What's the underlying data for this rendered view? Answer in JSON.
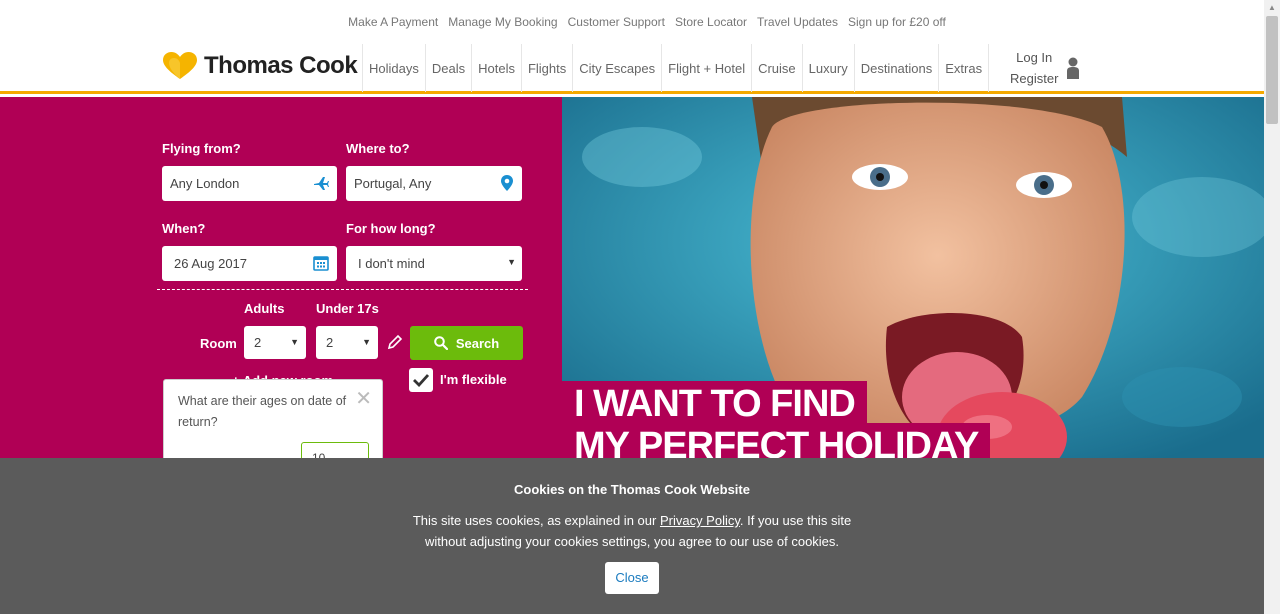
{
  "util_links": [
    "Make A Payment",
    "Manage My Booking",
    "Customer Support",
    "Store Locator",
    "Travel Updates",
    "Sign up for £20 off"
  ],
  "brand": {
    "name": "Thomas Cook",
    "accent": "#f5a900",
    "primary": "#b00055",
    "green": "#6cbb0c"
  },
  "nav": [
    "Holidays",
    "Deals",
    "Hotels",
    "Flights",
    "City Escapes",
    "Flight + Hotel",
    "Cruise",
    "Luxury",
    "Destinations",
    "Extras"
  ],
  "account": {
    "login": "Log In",
    "register": "Register",
    "icon": "user-icon"
  },
  "search": {
    "from_label": "Flying from?",
    "from_value": "Any London",
    "to_label": "Where to?",
    "to_value": "Portugal, Any",
    "when_label": "When?",
    "when_value": "26 Aug 2017",
    "duration_label": "For how long?",
    "duration_value": "I don't mind",
    "adults_label": "Adults",
    "under17_label": "Under 17s",
    "room_label": "Room",
    "adults_value": "2",
    "under17_value": "2",
    "search_label": "Search",
    "flexible_label": "I'm flexible",
    "add_room_label": "+ Add new room",
    "ages_prompt": "What are their ages on date of return?",
    "age_value": "10"
  },
  "hero": {
    "line1": "I WANT TO FIND",
    "line2": "MY PERFECT HOLIDAY"
  },
  "cookie": {
    "title": "Cookies on the Thomas Cook Website",
    "text_before": "This site uses cookies, as explained in our ",
    "link": "Privacy Policy",
    "text_after": ". If you use this site",
    "text_line2": "without adjusting your cookies settings, you agree to our use of cookies.",
    "close": "Close"
  }
}
